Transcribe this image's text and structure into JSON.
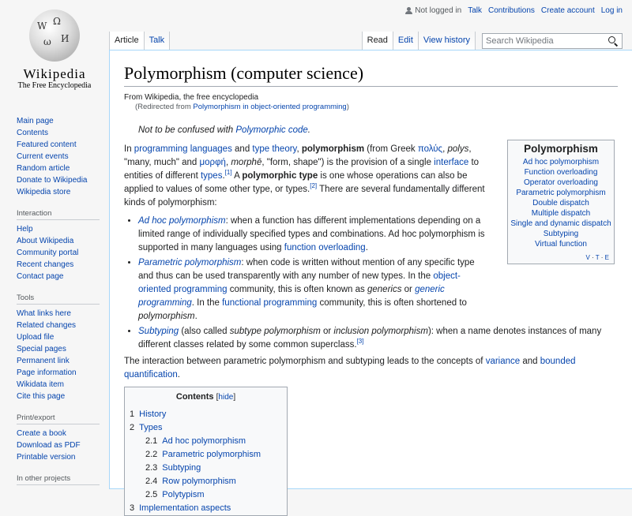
{
  "personal": {
    "not_logged_in": "Not logged in",
    "talk": "Talk",
    "contributions": "Contributions",
    "create_account": "Create account",
    "log_in": "Log in"
  },
  "logo": {
    "wordmark": "Wikipedia",
    "tagline": "The Free Encyclopedia"
  },
  "sidebar": {
    "navigation": [
      "Main page",
      "Contents",
      "Featured content",
      "Current events",
      "Random article",
      "Donate to Wikipedia",
      "Wikipedia store"
    ],
    "interaction_heading": "Interaction",
    "interaction": [
      "Help",
      "About Wikipedia",
      "Community portal",
      "Recent changes",
      "Contact page"
    ],
    "tools_heading": "Tools",
    "tools": [
      "What links here",
      "Related changes",
      "Upload file",
      "Special pages",
      "Permanent link",
      "Page information",
      "Wikidata item",
      "Cite this page"
    ],
    "print_heading": "Print/export",
    "print": [
      "Create a book",
      "Download as PDF",
      "Printable version"
    ],
    "other_heading": "In other projects"
  },
  "tabs": {
    "article": "Article",
    "talk": "Talk",
    "read": "Read",
    "edit": "Edit",
    "view_history": "View history"
  },
  "search": {
    "placeholder": "Search Wikipedia"
  },
  "article": {
    "title": "Polymorphism (computer science)",
    "site_sub": "From Wikipedia, the free encyclopedia",
    "redirect_prefix": "(Redirected from ",
    "redirect_link": "Polymorphism in object-oriented programming",
    "redirect_suffix": ")",
    "hatnote_prefix": "Not to be confused with ",
    "hatnote_link": "Polymorphic code",
    "hatnote_suffix": ".",
    "lead": {
      "t1": "In ",
      "l1": "programming languages",
      "t2": " and ",
      "l2": "type theory",
      "t3": ", ",
      "b1": "polymorphism",
      "t4": " (from Greek ",
      "l3": "πολύς",
      "t5": ", ",
      "i1": "polys",
      "t6": ", \"many, much\" and ",
      "l4": "μορφή",
      "t7": ", ",
      "i2": "morphē",
      "t8": ", \"form, shape\") is the provision of a single ",
      "l5": "interface",
      "t9": " to entities of different ",
      "l6": "types",
      "c1": "[1]",
      "t10": " A ",
      "b2": "polymorphic type",
      "t11": " is one whose operations can also be applied to values of some other type, or types.",
      "c2": "[2]",
      "t12": " There are several fundamentally different kinds of polymorphism:"
    },
    "items": {
      "adhoc_link": "Ad hoc polymorphism",
      "adhoc_text": ": when a function has different implementations depending on a limited range of individually specified types and combinations. Ad hoc polymorphism is supported in many languages using ",
      "adhoc_link2": "function overloading",
      "adhoc_end": ".",
      "param_link": "Parametric polymorphism",
      "param_text": ": when code is written without mention of any specific type and thus can be used transparently with any number of new types. In the ",
      "param_link2": "object-oriented programming",
      "param_text2": " community, this is often known as ",
      "param_i1": "generics",
      "param_text3": " or ",
      "param_link3": "generic programming",
      "param_text4": ". In the ",
      "param_link4": "functional programming",
      "param_text5": " community, this is often shortened to ",
      "param_i2": "polymorphism",
      "param_end": ".",
      "sub_link": "Subtyping",
      "sub_text1": " (also called ",
      "sub_i1": "subtype polymorphism",
      "sub_text2": " or ",
      "sub_i2": "inclusion polymorphism",
      "sub_text3": "): when a name denotes instances of many different classes related by some common superclass.",
      "sub_cite": "[3]"
    },
    "after": {
      "t1": "The interaction between parametric polymorphism and subtyping leads to the concepts of ",
      "l1": "variance",
      "t2": " and ",
      "l2": "bounded quantification",
      "t3": "."
    }
  },
  "infobox": {
    "title": "Polymorphism",
    "items": [
      "Ad hoc polymorphism",
      "Function overloading",
      "Operator overloading",
      "Parametric polymorphism",
      "Double dispatch",
      "Multiple dispatch",
      "Single and dynamic dispatch",
      "Subtyping",
      "Virtual function"
    ],
    "vte_v": "V",
    "vte_t": "T",
    "vte_e": "E",
    "vte_sep": " · "
  },
  "toc": {
    "title": "Contents",
    "toggle_open": "[",
    "toggle": "hide",
    "toggle_close": "]",
    "entries": [
      {
        "num": "1",
        "label": "History"
      },
      {
        "num": "2",
        "label": "Types"
      },
      {
        "num": "2.1",
        "label": "Ad hoc polymorphism"
      },
      {
        "num": "2.2",
        "label": "Parametric polymorphism"
      },
      {
        "num": "2.3",
        "label": "Subtyping"
      },
      {
        "num": "2.4",
        "label": "Row polymorphism"
      },
      {
        "num": "2.5",
        "label": "Polytypism"
      },
      {
        "num": "3",
        "label": "Implementation aspects"
      }
    ]
  }
}
